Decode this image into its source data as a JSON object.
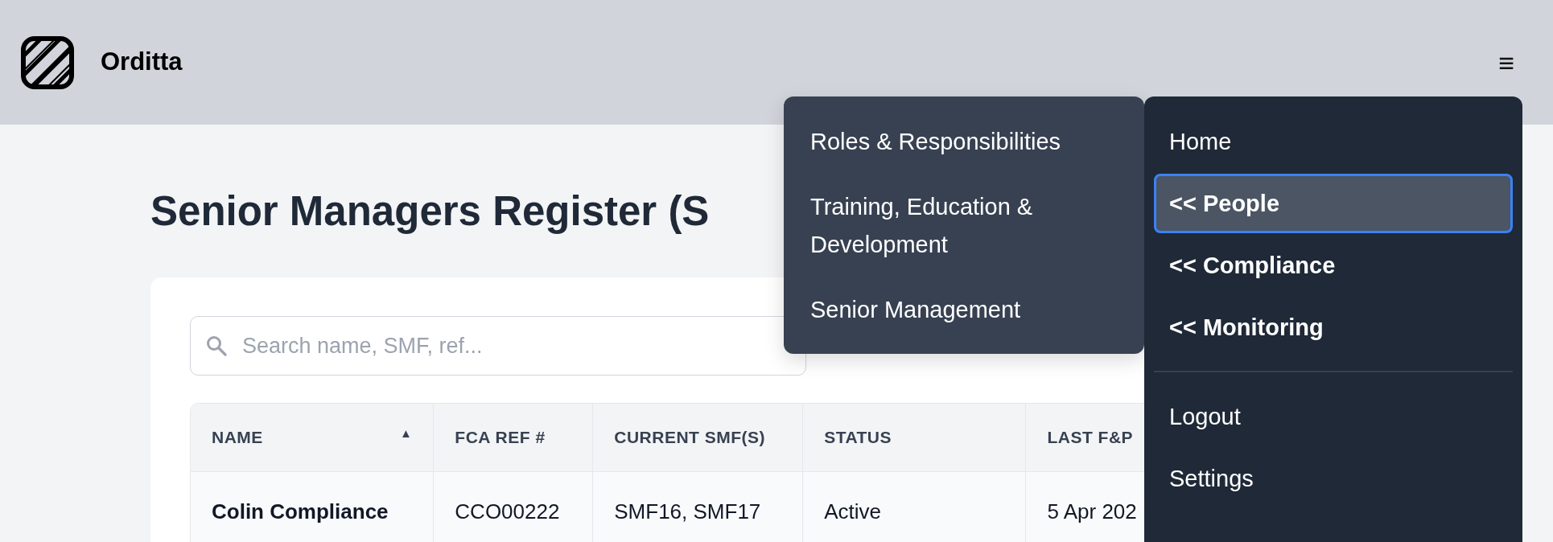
{
  "header": {
    "brand": "Orditta",
    "menu_toggle": "≡"
  },
  "page": {
    "title": "Senior Managers Register (S"
  },
  "search": {
    "placeholder": "Search name, SMF, ref..."
  },
  "table": {
    "columns": [
      {
        "label": "NAME",
        "sort_indicator": "▲"
      },
      {
        "label": "FCA REF #"
      },
      {
        "label": "CURRENT SMF(S)"
      },
      {
        "label": "STATUS"
      },
      {
        "label": "LAST F&P"
      }
    ],
    "rows": [
      [
        "Colin Compliance",
        "CCO00222",
        "SMF16, SMF17",
        "Active",
        "5 Apr 202"
      ]
    ]
  },
  "submenu": {
    "items": [
      {
        "label": "Roles & Responsibilities"
      },
      {
        "label": "Training, Education & Development"
      },
      {
        "label": "Senior Management"
      }
    ]
  },
  "menu": {
    "items": [
      {
        "kind": "link",
        "label": "Home",
        "selected": false
      },
      {
        "kind": "parent",
        "label": "<< People",
        "selected": true
      },
      {
        "kind": "parent",
        "label": "<< Compliance",
        "selected": false
      },
      {
        "kind": "parent",
        "label": "<< Monitoring",
        "selected": false
      },
      {
        "kind": "divider"
      },
      {
        "kind": "link",
        "label": "Logout",
        "selected": false
      },
      {
        "kind": "link",
        "label": "Settings",
        "selected": false
      }
    ]
  }
}
